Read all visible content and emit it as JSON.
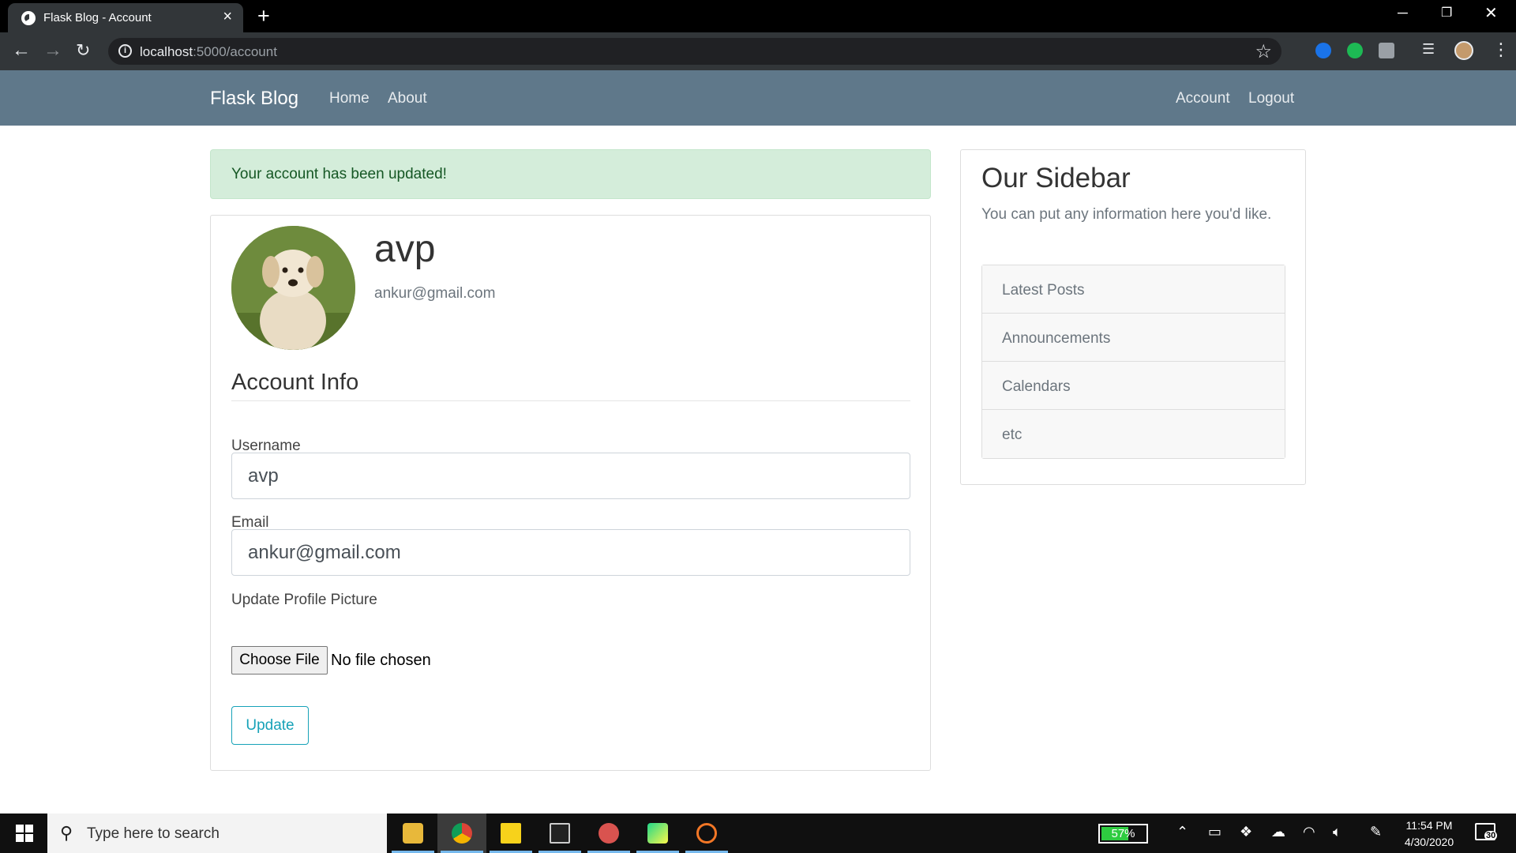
{
  "browser": {
    "tab_title": "Flask Blog - Account",
    "url_host": "localhost",
    "url_rest": ":5000/account"
  },
  "navbar": {
    "brand": "Flask Blog",
    "links": [
      "Home",
      "About"
    ],
    "right_links": [
      "Account",
      "Logout"
    ],
    "color": "#5f788a"
  },
  "alert": {
    "message": "Your account has been updated!",
    "color": "#d4edda"
  },
  "profile": {
    "username": "avp",
    "email": "ankur@gmail.com"
  },
  "form": {
    "legend": "Account Info",
    "username_label": "Username",
    "username_value": "avp",
    "email_label": "Email",
    "email_value": "ankur@gmail.com",
    "picture_label": "Update Profile Picture",
    "file_button": "Choose File",
    "file_status": "No file chosen",
    "submit": "Update"
  },
  "sidebar": {
    "title": "Our Sidebar",
    "text": "You can put any information here you'd like.",
    "items": [
      "Latest Posts",
      "Announcements",
      "Calendars",
      "etc"
    ]
  },
  "taskbar": {
    "search_placeholder": "Type here to search",
    "battery": "57%",
    "time": "11:54 PM",
    "date": "4/30/2020",
    "notifications": "30"
  }
}
